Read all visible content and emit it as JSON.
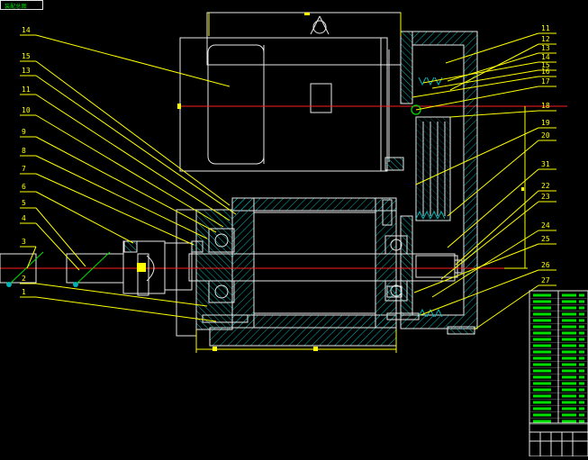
{
  "drawing_tag": "装配总图",
  "left_labels": [
    "14",
    "15",
    "13",
    "11",
    "10",
    "9",
    "8",
    "7",
    "6",
    "5",
    "4",
    "3",
    "2",
    "1"
  ],
  "right_labels": [
    "11",
    "12",
    "13",
    "14",
    "15",
    "16",
    "17",
    "18",
    "19",
    "20",
    "31",
    "22",
    "23",
    "24",
    "25",
    "26",
    "27"
  ],
  "colors": {
    "background": "#000000",
    "outline": "#e8e8e8",
    "leader": "#ffff00",
    "centerline": "#ff2020",
    "hatch": "#00b4b4",
    "table": "#00e000",
    "dimension": "#ffff00"
  }
}
